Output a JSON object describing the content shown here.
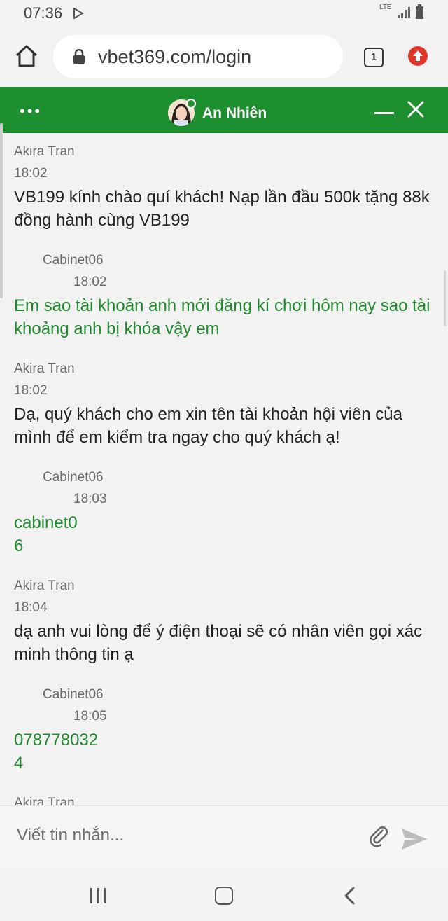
{
  "status_bar": {
    "time": "07:36",
    "network": "LTE"
  },
  "browser": {
    "url": "vbet369.com/login",
    "tab_count": "1"
  },
  "chat": {
    "agent_name": "An Nhiên",
    "messages": [
      {
        "type": "in",
        "sender": "Akira Tran",
        "time": "18:02",
        "text": "VB199 kính chào quí khách! Nạp lần đầu 500k tặng 88k đồng hành cùng VB199"
      },
      {
        "type": "out",
        "sender": "Cabinet06",
        "time": "18:02",
        "text": "Em sao tài khoản anh mới đăng kí chơi hôm nay sao tài khoảng anh bị khóa vậy em"
      },
      {
        "type": "in",
        "sender": "Akira Tran",
        "time": "18:02",
        "text": "Dạ, quý khách cho em xin tên tài khoản hội viên của mình để em kiểm tra ngay cho quý khách ạ!"
      },
      {
        "type": "out",
        "sender": "Cabinet06",
        "time": "18:03",
        "text": "cabinet0\n6"
      },
      {
        "type": "in",
        "sender": "Akira Tran",
        "time": "18:04",
        "text": "dạ anh vui lòng để ý điện thoại sẽ có nhân viên gọi xác minh thông tin ạ"
      },
      {
        "type": "out",
        "sender": "Cabinet06",
        "time": "18:05",
        "text": "078778032\n4"
      },
      {
        "type": "in",
        "sender": "Akira Tran",
        "time": "",
        "text": ""
      }
    ],
    "input_placeholder": "Viết tin nhắn..."
  },
  "colors": {
    "brand_green": "#1e8f2e",
    "out_text": "#1e8a2c",
    "update_badge": "#e0352a"
  },
  "icons": [
    "play-store-icon",
    "signal-icon",
    "battery-icon",
    "home-icon",
    "lock-icon",
    "tabs-icon",
    "update-icon",
    "more-icon",
    "avatar",
    "minimize-icon",
    "close-icon",
    "attach-icon",
    "send-icon",
    "recent-apps-icon",
    "nav-home-icon",
    "back-icon"
  ]
}
